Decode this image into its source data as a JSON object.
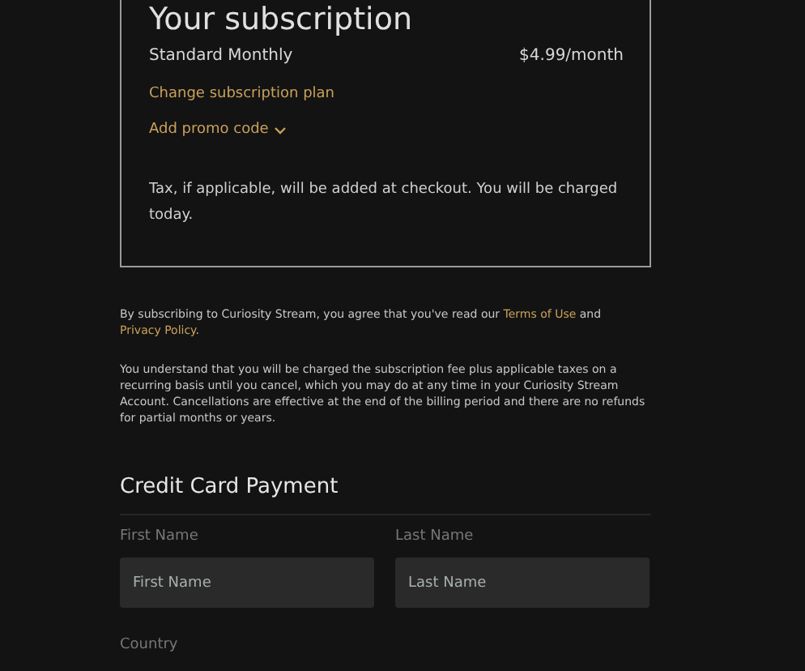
{
  "subscription": {
    "title": "Your subscription",
    "plan": "Standard Monthly",
    "price": "$4.99/month",
    "change_link": "Change subscription plan",
    "promo_link": "Add promo code",
    "tax_note": "Tax, if applicable, will be added at checkout. You will be charged today."
  },
  "agreement": {
    "text": "By subscribing to Curiosity Stream, you agree that you've read our",
    "terms_link": "Terms of Use",
    "joiner": "and",
    "privacy_link": "Privacy Policy",
    "end": "."
  },
  "billing_note": "You understand that you will be charged the subscription fee plus applicable taxes on a recurring basis until you cancel, which you may do at any time in your Curiosity Stream Account. Cancellations are effective at the end of the billing period and there are no refunds for partial months or years.",
  "payment": {
    "title": "Credit Card Payment",
    "fields": [
      {
        "label": "First Name",
        "placeholder": "First Name"
      },
      {
        "label": "Last Name",
        "placeholder": "Last Name"
      }
    ],
    "country_label": "Country"
  }
}
